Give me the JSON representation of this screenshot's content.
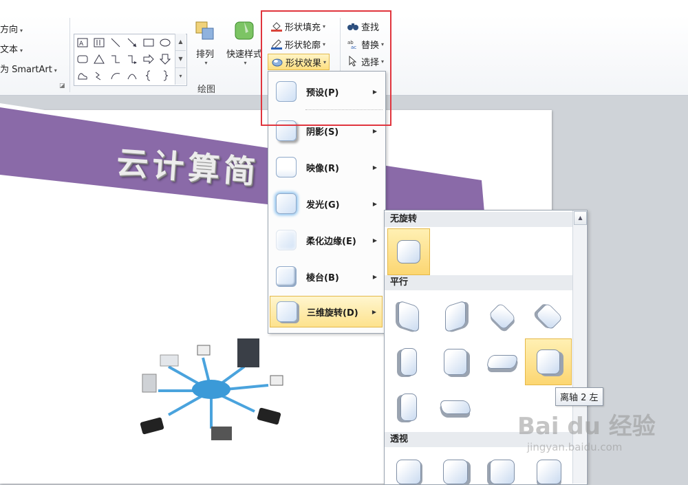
{
  "ribbon": {
    "left_items": [
      {
        "label": "方向",
        "caret": "▾"
      },
      {
        "label": "文本",
        "caret": "▾"
      },
      {
        "label": "为 SmartArt",
        "caret": "▾"
      }
    ],
    "arrange_label": "排列",
    "quick_styles_label": "快速样式",
    "drawing_group_label": "绘图",
    "shape_fill_label": "形状填充",
    "shape_outline_label": "形状轮廓",
    "shape_effects_label": "形状效果",
    "find_label": "查找",
    "replace_label": "替换",
    "select_label": "选择"
  },
  "slide": {
    "title": "云计算简"
  },
  "effects_menu": {
    "items": [
      {
        "label": "预设(P)"
      },
      {
        "label": "阴影(S)"
      },
      {
        "label": "映像(R)"
      },
      {
        "label": "发光(G)"
      },
      {
        "label": "柔化边缘(E)"
      },
      {
        "label": "棱台(B)"
      },
      {
        "label": "三维旋转(D)"
      }
    ]
  },
  "rotation_panel": {
    "sections": {
      "no_rotation": "无旋转",
      "parallel": "平行",
      "perspective": "透视"
    },
    "tooltip": "离轴 2 左"
  },
  "watermark": {
    "logo": "Bai du 经验",
    "url": "jingyan.baidu.com"
  },
  "colors": {
    "banner": "#8a6aa8",
    "highlight": "#fcd672",
    "annotation": "#e0343d"
  }
}
